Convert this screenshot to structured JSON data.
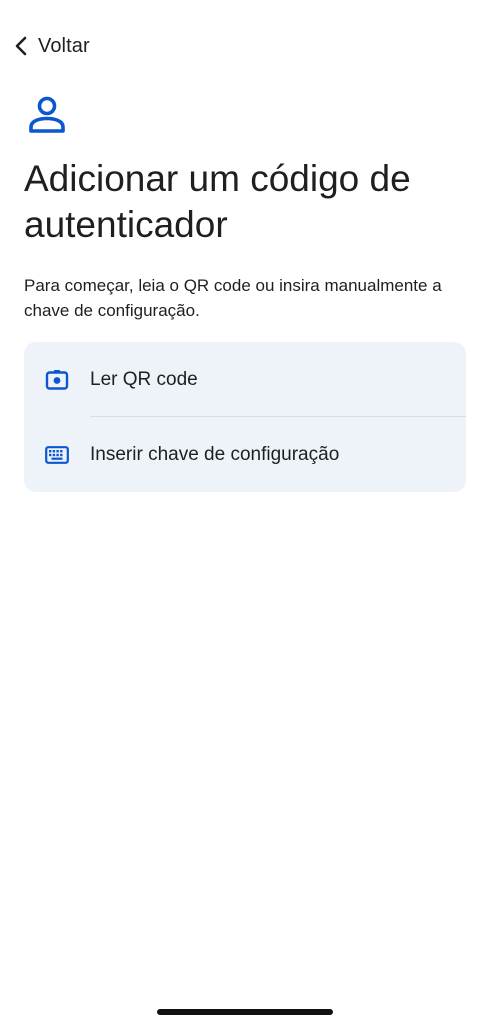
{
  "nav": {
    "back_label": "Voltar",
    "back_icon": "chevron-left-icon"
  },
  "header": {
    "icon": "account-icon",
    "title": "Adicionar um código de autenticador",
    "subtitle": "Para começar, leia o QR code ou insira manualmente a chave de configuração."
  },
  "options": [
    {
      "icon": "camera-icon",
      "label": "Ler QR code"
    },
    {
      "icon": "keyboard-icon",
      "label": "Inserir chave de configuração"
    }
  ],
  "colors": {
    "accent": "#0b57d0",
    "card_background": "#eef3fa",
    "text": "#1f1f1f",
    "divider": "#d9dde3"
  }
}
